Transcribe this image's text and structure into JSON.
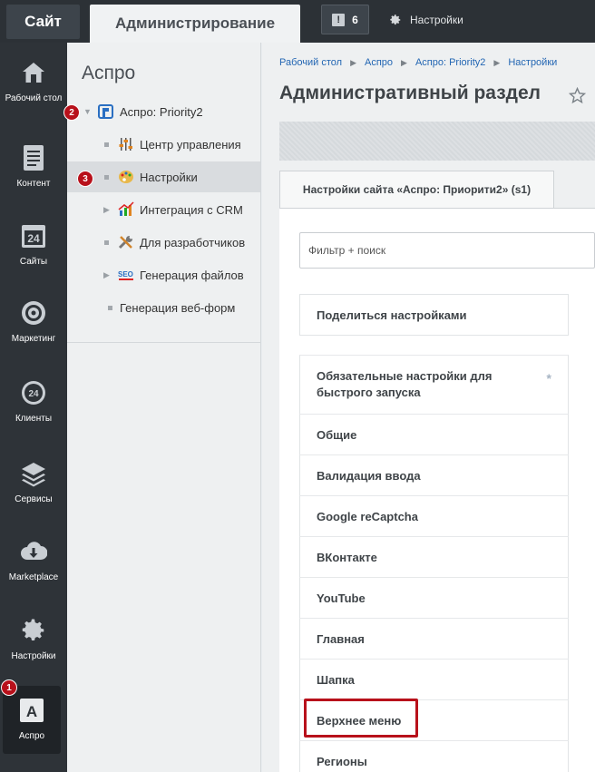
{
  "topbar": {
    "site_tab": "Сайт",
    "admin_tab": "Администрирование",
    "notifications_count": "6",
    "settings_label": "Настройки"
  },
  "leftnav": {
    "items": [
      {
        "label": "Рабочий стол",
        "icon": "home-icon"
      },
      {
        "label": "Контент",
        "icon": "document-icon"
      },
      {
        "label": "Сайты",
        "icon": "calendar-24-icon"
      },
      {
        "label": "Маркетинг",
        "icon": "target-icon"
      },
      {
        "label": "Клиенты",
        "icon": "clients-24-icon"
      },
      {
        "label": "Сервисы",
        "icon": "layers-icon"
      },
      {
        "label": "Marketplace",
        "icon": "cloud-download-icon"
      },
      {
        "label": "Настройки",
        "icon": "gear-icon"
      },
      {
        "label": "Аспро",
        "icon": "aspro-logo-icon"
      }
    ],
    "badge": "1"
  },
  "submenu": {
    "title": "Аспро",
    "badges": [
      "2",
      "3"
    ],
    "items": [
      {
        "label": "Аспро: Priority2",
        "icon": "priority-logo-icon"
      },
      {
        "label": "Центр управления",
        "icon": "sliders-icon"
      },
      {
        "label": "Настройки",
        "icon": "palette-icon"
      },
      {
        "label": "Интеграция с CRM",
        "icon": "chart-icon"
      },
      {
        "label": "Для разработчиков",
        "icon": "tools-icon"
      },
      {
        "label": "Генерация файлов",
        "icon": "seo-icon"
      },
      {
        "label": "Генерация веб-форм",
        "icon": ""
      }
    ]
  },
  "main": {
    "breadcrumb": [
      "Рабочий стол",
      "Аспро",
      "Аспро: Priority2",
      "Настройки"
    ],
    "title": "Административный раздел",
    "tab_label": "Настройки сайта «Аспро: Приорити2» (s1)",
    "filter_placeholder": "Фильтр + поиск",
    "share_label": "Поделиться настройками",
    "sections": [
      "Обязательные настройки для быстрого запуска",
      "Общие",
      "Валидация ввода",
      "Google reCaptcha",
      "ВКонтакте",
      "YouTube",
      "Главная",
      "Шапка",
      "Верхнее меню",
      "Регионы"
    ]
  },
  "colors": {
    "accent_red": "#b8111b",
    "link_blue": "#2366b3",
    "dark_bg": "#2e3338"
  }
}
